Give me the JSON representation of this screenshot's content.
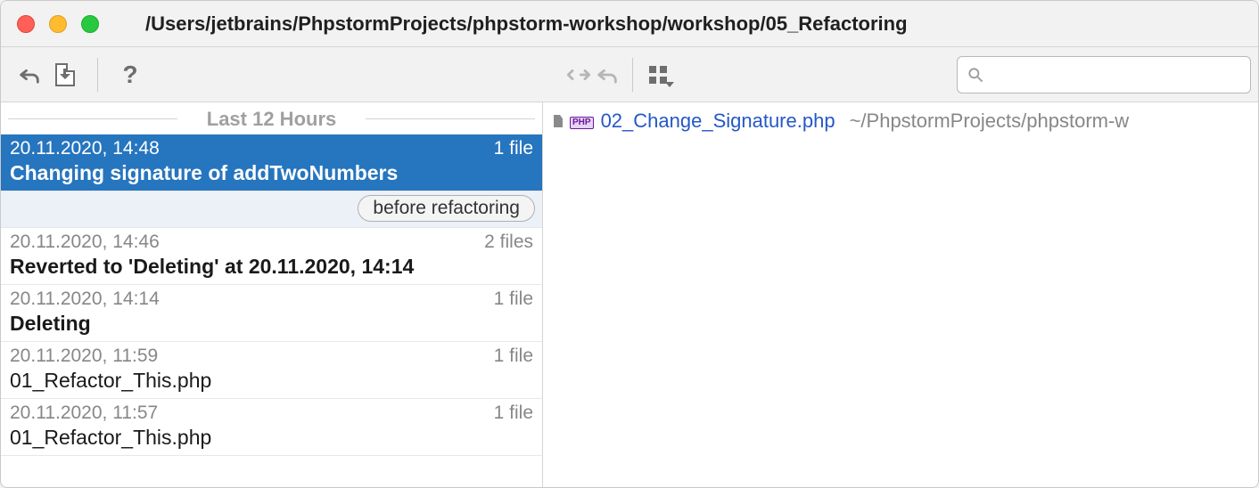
{
  "window": {
    "title": "/Users/jetbrains/PhpstormProjects/phpstorm-workshop/workshop/05_Refactoring"
  },
  "search": {
    "placeholder": ""
  },
  "history": {
    "group_header": "Last 12 Hours",
    "items": [
      {
        "date": "20.11.2020, 14:48",
        "files": "1 file",
        "title": "Changing signature of addTwoNumbers",
        "selected": true,
        "bold": true
      },
      {
        "date": "20.11.2020, 14:46",
        "files": "2 files",
        "title": "Reverted to 'Deleting' at 20.11.2020, 14:14",
        "selected": false,
        "bold": true
      },
      {
        "date": "20.11.2020, 14:14",
        "files": "1 file",
        "title": "Deleting",
        "selected": false,
        "bold": true
      },
      {
        "date": "20.11.2020, 11:59",
        "files": "1 file",
        "title": "01_Refactor_This.php",
        "selected": false,
        "bold": false
      },
      {
        "date": "20.11.2020, 11:57",
        "files": "1 file",
        "title": "01_Refactor_This.php",
        "selected": false,
        "bold": false
      }
    ],
    "tag": "before refactoring"
  },
  "detail": {
    "file_name": "02_Change_Signature.php",
    "file_path": "~/PhpstormProjects/phpstorm-w"
  }
}
